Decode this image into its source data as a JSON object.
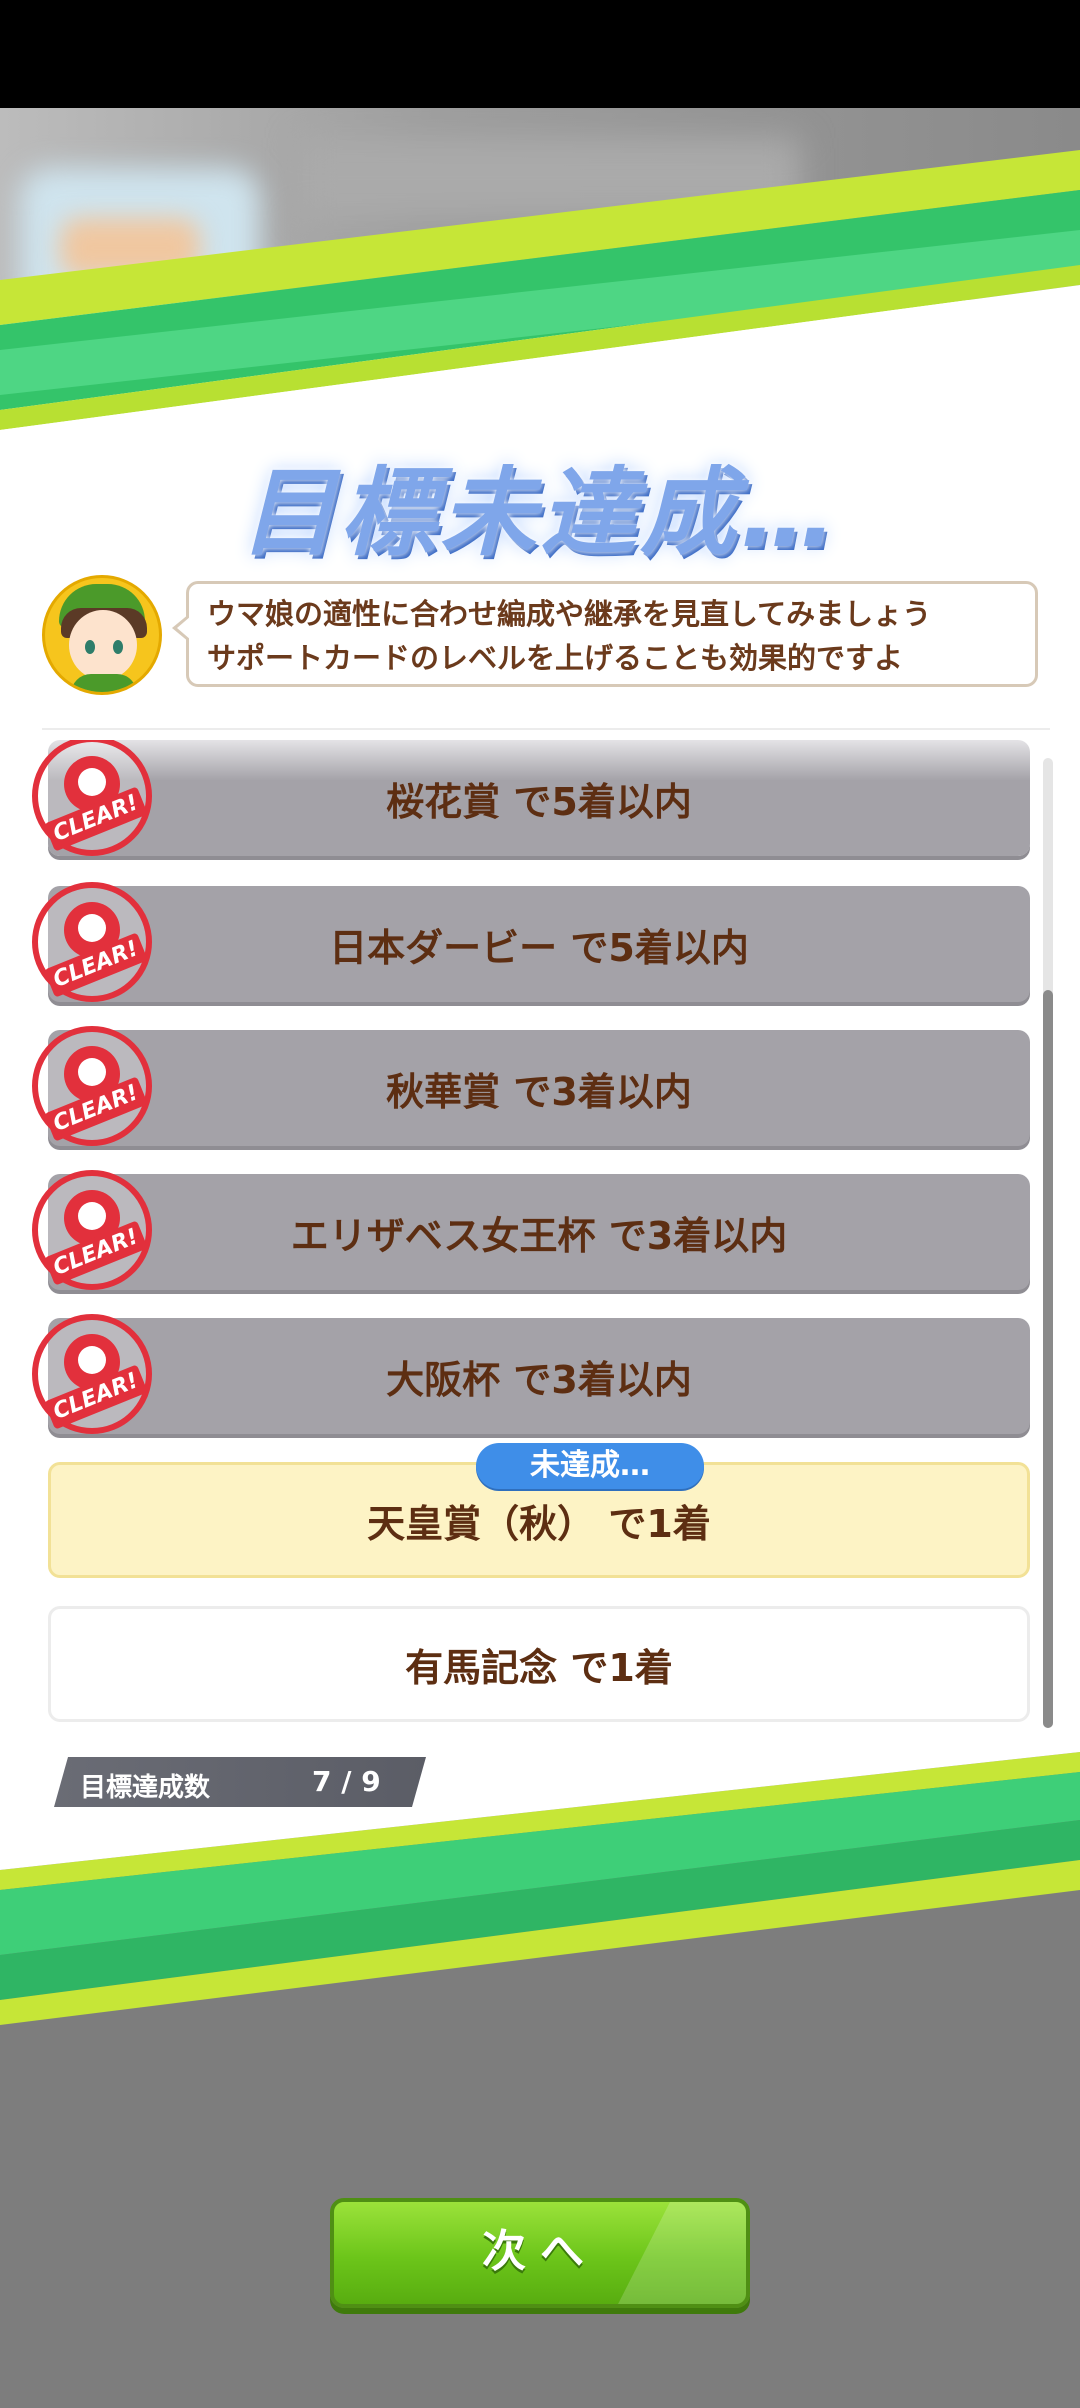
{
  "title": "目標未達成…",
  "advice": {
    "line1": "ウマ娘の適性に合わせ編成や継承を見直してみましょう",
    "line2": "サポートカードのレベルを上げることも効果的ですよ"
  },
  "goals": [
    {
      "label": "桜花賞 で5着以内",
      "status": "cleared"
    },
    {
      "label": "日本ダービー で5着以内",
      "status": "cleared"
    },
    {
      "label": "秋華賞 で3着以内",
      "status": "cleared"
    },
    {
      "label": "エリザベス女王杯 で3着以内",
      "status": "cleared"
    },
    {
      "label": "大阪杯 で3着以内",
      "status": "cleared"
    },
    {
      "label": "天皇賞（秋） で1着",
      "status": "failed"
    },
    {
      "label": "有馬記念 で1着",
      "status": "pending"
    }
  ],
  "clear_stamp_text": "CLEAR!",
  "failed_badge": "未達成…",
  "counter": {
    "label": "目標達成数",
    "value": "7 / 9"
  },
  "next_button": "次へ",
  "colors": {
    "cleared_row": "#a4a2a8",
    "failed_row": "#fdf3c5",
    "badge": "#3f8ee8",
    "accent_green": "#6cc51a",
    "stamp_red": "#e2303c"
  }
}
